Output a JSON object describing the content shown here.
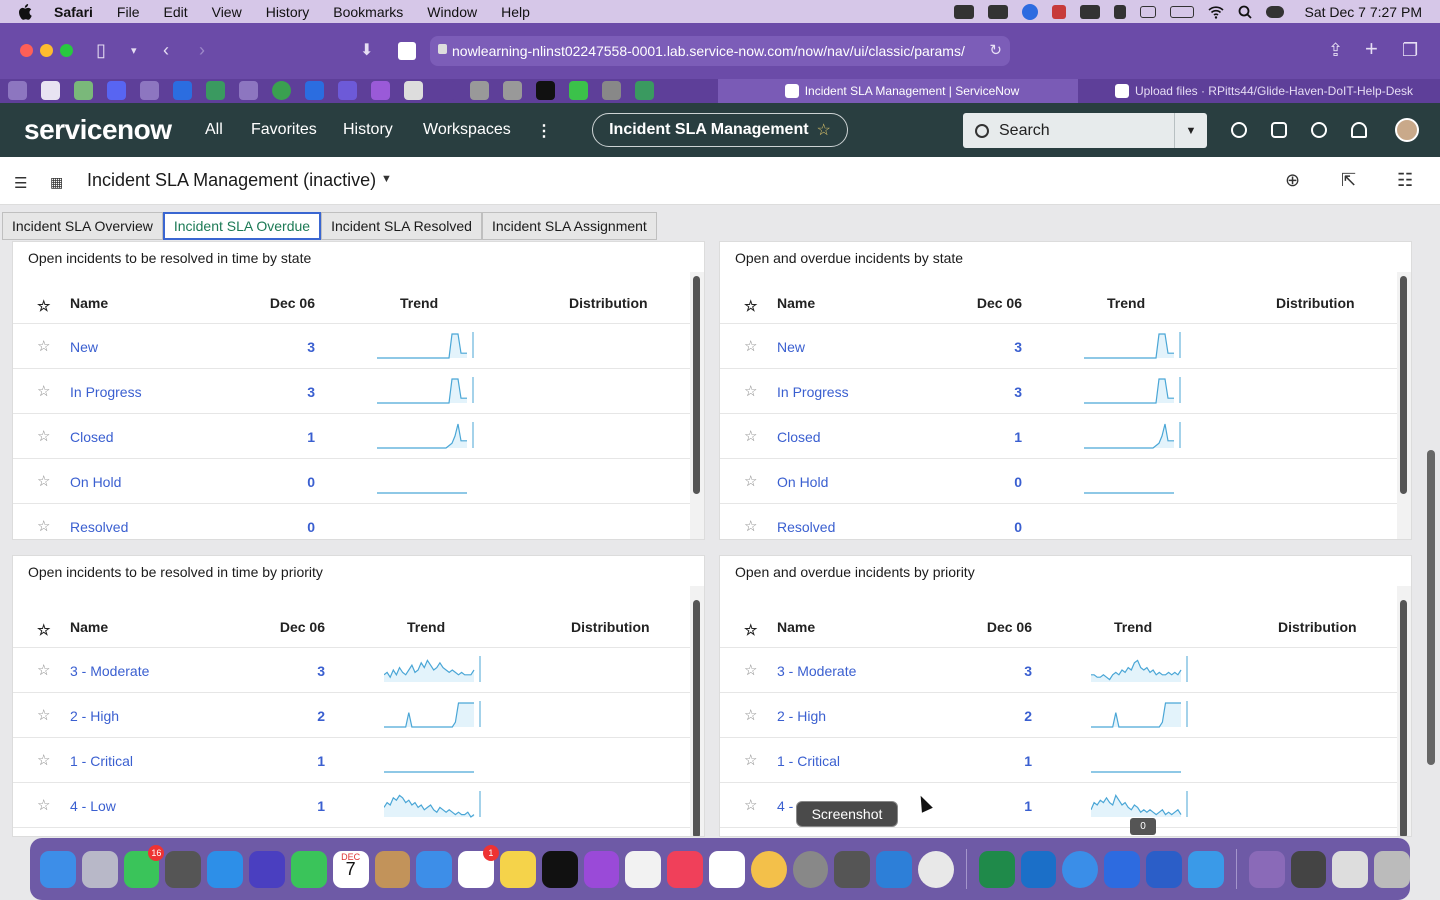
{
  "menubar": {
    "items": [
      "Safari",
      "File",
      "Edit",
      "View",
      "History",
      "Bookmarks",
      "Window",
      "Help"
    ],
    "clock": "Sat Dec 7  7:27 PM"
  },
  "browser": {
    "url": "nowlearning-nlinst02247558-0001.lab.service-now.com/now/nav/ui/classic/params/",
    "active_tab": "Incident SLA Management | ServiceNow",
    "other_tab": "Upload files · RPitts44/Glide-Haven-DoIT-Help-Desk"
  },
  "sn": {
    "logo": "servicenow",
    "nav": [
      "All",
      "Favorites",
      "History",
      "Workspaces"
    ],
    "more": "⋮",
    "context_pill": "Incident SLA Management",
    "search_label": "Search"
  },
  "dashboard": {
    "title": "Incident SLA Management (inactive)",
    "tabs": [
      "Incident SLA Overview",
      "Incident SLA Overdue",
      "Incident SLA Resolved",
      "Incident SLA Assignment"
    ],
    "active_tab": 1
  },
  "widgets": [
    {
      "title": "Open incidents to be resolved in time by state",
      "headers": {
        "name": "Name",
        "date": "Dec 06",
        "trend": "Trend",
        "distribution": "Distribution"
      },
      "rows": [
        {
          "name": "New",
          "value": "3",
          "trend": [
            0,
            0,
            0,
            0,
            0,
            0,
            0,
            0,
            0,
            0,
            0,
            0,
            0,
            0,
            0,
            0,
            0,
            0,
            0,
            0,
            0,
            0,
            0,
            0,
            0,
            1,
            1,
            1,
            0.2,
            0.2,
            0.2
          ]
        },
        {
          "name": "In Progress",
          "value": "3",
          "trend": [
            0,
            0,
            0,
            0,
            0,
            0,
            0,
            0,
            0,
            0,
            0,
            0,
            0,
            0,
            0,
            0,
            0,
            0,
            0,
            0,
            0,
            0,
            0,
            0,
            0,
            1,
            1,
            1,
            0.2,
            0.2,
            0.2
          ]
        },
        {
          "name": "Closed",
          "value": "1",
          "trend": [
            0,
            0,
            0,
            0,
            0,
            0,
            0,
            0,
            0,
            0,
            0,
            0,
            0,
            0,
            0,
            0,
            0,
            0,
            0,
            0,
            0,
            0,
            0,
            0,
            0.1,
            0.2,
            0.5,
            1,
            0.3,
            0.3,
            0.3
          ]
        },
        {
          "name": "On Hold",
          "value": "0",
          "trend": [
            0,
            0,
            0,
            0,
            0,
            0,
            0,
            0,
            0,
            0,
            0,
            0,
            0,
            0,
            0,
            0,
            0,
            0,
            0,
            0,
            0,
            0,
            0,
            0,
            0,
            0,
            0,
            0
          ]
        },
        {
          "name": "Resolved",
          "value": "0",
          "trend": []
        }
      ]
    },
    {
      "title": "Open and overdue incidents by state",
      "headers": {
        "name": "Name",
        "date": "Dec 06",
        "trend": "Trend",
        "distribution": "Distribution"
      },
      "rows": [
        {
          "name": "New",
          "value": "3",
          "trend": [
            0,
            0,
            0,
            0,
            0,
            0,
            0,
            0,
            0,
            0,
            0,
            0,
            0,
            0,
            0,
            0,
            0,
            0,
            0,
            0,
            0,
            0,
            0,
            0,
            0,
            1,
            1,
            1,
            0.2,
            0.2,
            0.2
          ]
        },
        {
          "name": "In Progress",
          "value": "3",
          "trend": [
            0,
            0,
            0,
            0,
            0,
            0,
            0,
            0,
            0,
            0,
            0,
            0,
            0,
            0,
            0,
            0,
            0,
            0,
            0,
            0,
            0,
            0,
            0,
            0,
            0,
            1,
            1,
            1,
            0.2,
            0.2,
            0.2
          ]
        },
        {
          "name": "Closed",
          "value": "1",
          "trend": [
            0,
            0,
            0,
            0,
            0,
            0,
            0,
            0,
            0,
            0,
            0,
            0,
            0,
            0,
            0,
            0,
            0,
            0,
            0,
            0,
            0,
            0,
            0,
            0,
            0.1,
            0.2,
            0.5,
            1,
            0.3,
            0.3,
            0.3
          ]
        },
        {
          "name": "On Hold",
          "value": "0",
          "trend": [
            0,
            0,
            0,
            0,
            0,
            0,
            0,
            0,
            0,
            0,
            0,
            0,
            0,
            0,
            0,
            0,
            0,
            0,
            0,
            0,
            0,
            0,
            0,
            0,
            0,
            0,
            0,
            0
          ]
        },
        {
          "name": "Resolved",
          "value": "0",
          "trend": []
        }
      ]
    },
    {
      "title": "Open incidents to be resolved in time by priority",
      "headers": {
        "name": "Name",
        "date": "Dec 06",
        "trend": "Trend",
        "distribution": "Distribution"
      },
      "rows": [
        {
          "name": "3 - Moderate",
          "value": "3",
          "trend": [
            0.3,
            0.4,
            0.2,
            0.5,
            0.3,
            0.6,
            0.4,
            0.3,
            0.5,
            0.7,
            0.4,
            0.5,
            0.8,
            0.6,
            0.9,
            0.7,
            0.5,
            0.6,
            0.8,
            0.6,
            0.5,
            0.4,
            0.5,
            0.4,
            0.3,
            0.4,
            0.3,
            0.3,
            0.3,
            0.5
          ]
        },
        {
          "name": "2 - High",
          "value": "2",
          "trend": [
            0,
            0,
            0,
            0,
            0,
            0,
            0,
            0,
            0.6,
            0,
            0,
            0,
            0,
            0,
            0,
            0,
            0,
            0,
            0,
            0,
            0,
            0,
            0,
            0.2,
            1,
            1,
            1,
            1,
            1,
            1
          ]
        },
        {
          "name": "1 - Critical",
          "value": "1",
          "trend": [
            0,
            0,
            0,
            0,
            0,
            0,
            0,
            0,
            0,
            0,
            0,
            0,
            0,
            0,
            0,
            0,
            0,
            0,
            0,
            0,
            0,
            0,
            0,
            0,
            0,
            0,
            0,
            0,
            0
          ]
        },
        {
          "name": "4 - Low",
          "value": "1",
          "trend": [
            0.4,
            0.6,
            0.5,
            0.8,
            0.7,
            0.9,
            0.8,
            0.6,
            0.7,
            0.5,
            0.6,
            0.4,
            0.5,
            0.3,
            0.4,
            0.5,
            0.3,
            0.2,
            0.4,
            0.3,
            0.2,
            0.3,
            0.2,
            0.1,
            0.2,
            0.1,
            0.1,
            0.2,
            0,
            0.1
          ]
        }
      ]
    },
    {
      "title": "Open and overdue incidents by priority",
      "headers": {
        "name": "Name",
        "date": "Dec 06",
        "trend": "Trend",
        "distribution": "Distribution"
      },
      "rows": [
        {
          "name": "3 - Moderate",
          "value": "3",
          "trend": [
            0.3,
            0.3,
            0.2,
            0.2,
            0.3,
            0.2,
            0.1,
            0.3,
            0.4,
            0.3,
            0.5,
            0.4,
            0.6,
            0.5,
            0.8,
            0.9,
            0.6,
            0.5,
            0.6,
            0.4,
            0.5,
            0.3,
            0.4,
            0.3,
            0.3,
            0.4,
            0.3,
            0.4,
            0.3,
            0.5
          ]
        },
        {
          "name": "2 - High",
          "value": "2",
          "trend": [
            0,
            0,
            0,
            0,
            0,
            0,
            0,
            0,
            0.6,
            0,
            0,
            0,
            0,
            0,
            0,
            0,
            0,
            0,
            0,
            0,
            0,
            0,
            0,
            0.2,
            1,
            1,
            1,
            1,
            1,
            1
          ]
        },
        {
          "name": "1 - Critical",
          "value": "1",
          "trend": [
            0,
            0,
            0,
            0,
            0,
            0,
            0,
            0,
            0,
            0,
            0,
            0,
            0,
            0,
            0,
            0,
            0,
            0,
            0,
            0,
            0,
            0,
            0,
            0,
            0,
            0,
            0,
            0,
            0
          ]
        },
        {
          "name": "4 - ",
          "value": "1",
          "trend": [
            0.3,
            0.6,
            0.5,
            0.7,
            0.6,
            0.8,
            0.6,
            0.5,
            0.9,
            0.7,
            0.5,
            0.6,
            0.4,
            0.3,
            0.5,
            0.4,
            0.2,
            0.3,
            0.2,
            0.3,
            0.2,
            0.1,
            0.2,
            0.3,
            0.1,
            0.2,
            0.1,
            0.2,
            0.3,
            0.1
          ]
        }
      ]
    }
  ],
  "tooltip": "Screenshot",
  "count_badge": "0",
  "dock": {
    "badges": {
      "messages": "16",
      "reminders": "1"
    },
    "calendar_month": "DEC",
    "calendar_day": "7"
  },
  "colors": {
    "sn_header": "#293e40",
    "link_blue": "#3a5fd0",
    "sparkline": "#4aa6d6",
    "active_tab_border": "#3a66d1"
  }
}
